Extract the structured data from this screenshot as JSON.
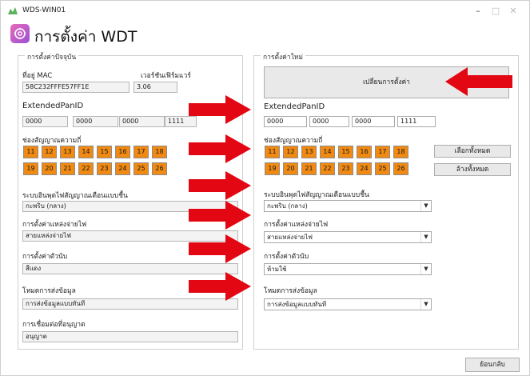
{
  "window": {
    "title": "WDS-WIN01",
    "minimize": "–",
    "maximize": "□",
    "close": "✕"
  },
  "header": {
    "title": "การตั้งค่า WDT"
  },
  "current": {
    "group_label": "การตั้งค่าปัจจุบัน",
    "mac_label": "ที่อยู่ MAC",
    "mac_value": "58C232FFFE57FF1E",
    "fw_label": "เวอร์ชันเฟิร์มแวร์",
    "fw_value": "3.06",
    "panid_label": "ExtendedPanID",
    "panid": [
      "0000",
      "0000",
      "0000",
      "1111"
    ],
    "channel_label": "ช่องสัญญาณความถี่",
    "channels_row1": [
      "11",
      "12",
      "13",
      "14",
      "15",
      "16",
      "17",
      "18"
    ],
    "channels_row2": [
      "19",
      "20",
      "21",
      "22",
      "23",
      "24",
      "25",
      "26"
    ],
    "sensor_label": "ระบบอินพุตไฟสัญญาณเตือนแบบชื้น",
    "sensor_value": "กะพริบ (กลาง)",
    "power_label": "การตั้งค่าแหล่งจ่ายไฟ",
    "power_value": "สายแหล่งจ่ายไฟ",
    "color_label": "การตั้งค่าตัวนับ",
    "color_value": "สีแดง",
    "mode_label": "โหมดการส่งข้อมูล",
    "mode_value": "การส่งข้อมูลแบบทันที",
    "conn_label": "การเชื่อมต่อที่อนุญาต",
    "conn_value": "อนุญาต"
  },
  "new": {
    "group_label": "การตั้งค่าใหม่",
    "apply_button": "เปลี่ยนการตั้งค่า",
    "panid_label": "ExtendedPanID",
    "panid": [
      "0000",
      "0000",
      "0000",
      "1111"
    ],
    "channel_label": "ช่องสัญญาณความถี่",
    "channels_row1": [
      "11",
      "12",
      "13",
      "14",
      "15",
      "16",
      "17",
      "18"
    ],
    "channels_row2": [
      "19",
      "20",
      "21",
      "22",
      "23",
      "24",
      "25",
      "26"
    ],
    "select_all": "เลือกทั้งหมด",
    "clear_all": "ล้างทั้งหมด",
    "sensor_label": "ระบบอินพุตไฟสัญญาณเตือนแบบชื้น",
    "sensor_value": "กะพริบ (กลาง)",
    "power_label": "การตั้งค่าแหล่งจ่ายไฟ",
    "power_value": "สายแหล่งจ่ายไฟ",
    "color_label": "การตั้งค่าตัวนับ",
    "color_value": "ห้ามใช้",
    "mode_label": "โหมดการส่งข้อมูล",
    "mode_value": "การส่งข้อมูลแบบทันที"
  },
  "footer": {
    "back_button": "ย้อนกลับ"
  },
  "colors": {
    "channel_orange": "#f08a13",
    "arrow_red": "#e30613",
    "icon_pink": "#e76bb9"
  }
}
